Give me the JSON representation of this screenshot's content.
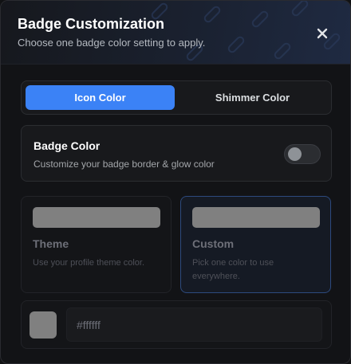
{
  "dialog": {
    "title": "Badge Customization",
    "subtitle": "Choose one badge color setting to apply."
  },
  "close_icon": "close-icon",
  "tabs": [
    {
      "label": "Icon Color",
      "active": true
    },
    {
      "label": "Shimmer Color",
      "active": false
    }
  ],
  "badge_color": {
    "title": "Badge Color",
    "description": "Customize your badge border & glow color",
    "enabled": false
  },
  "options": [
    {
      "title": "Theme",
      "description": "Use your profile theme color.",
      "selected": false
    },
    {
      "title": "Custom",
      "description": "Pick one color to use everywhere.",
      "selected": true
    }
  ],
  "color_input": {
    "value": "#ffffff",
    "swatch_color": "#808080"
  },
  "colors": {
    "accent": "#3b82f6",
    "custom_border": "#2d4a7e",
    "swatch": "#808080"
  }
}
